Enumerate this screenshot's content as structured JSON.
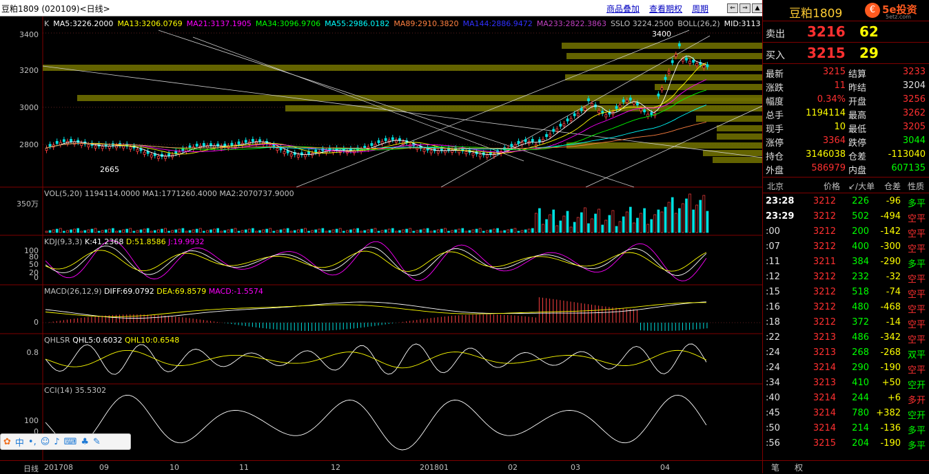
{
  "window": {
    "title": "豆粕1809 (020109)<日线>",
    "links": [
      "商品叠加",
      "查看期权",
      "周期"
    ],
    "nav_buttons": [
      "⇐",
      "⇒",
      "▲",
      "▼"
    ]
  },
  "main_chart": {
    "indicator_line": [
      {
        "text": "K",
        "color": "#c0c0c0"
      },
      {
        "text": "MA5:3226.2000",
        "color": "#ffffff"
      },
      {
        "text": "MA13:3206.0769",
        "color": "#ffff00"
      },
      {
        "text": "MA21:3137.1905",
        "color": "#ff00ff"
      },
      {
        "text": "MA34:3096.9706",
        "color": "#00ff00"
      },
      {
        "text": "MA55:2986.0182",
        "color": "#00ffff"
      },
      {
        "text": "MA89:2910.3820",
        "color": "#ff8040"
      },
      {
        "text": "MA144:2886.9472",
        "color": "#3030ff"
      },
      {
        "text": "MA233:2822.3863",
        "color": "#c040c0"
      },
      {
        "text": "SSLO 3224.2500",
        "color": "#c0c0c0"
      },
      {
        "text": "BOLL(26,2)",
        "color": "#c0c0c0"
      },
      {
        "text": "MID:3113",
        "color": "#ffffff"
      }
    ],
    "y_labels": [
      "3400",
      "3200",
      "3000",
      "2800"
    ],
    "peak_label": "3400",
    "low_label": "2665"
  },
  "vol_panel": {
    "label": "VOL(5,20) 1194114.0000 MA1:1771260.4000 MA2:2070737.9000",
    "y_label": "350万"
  },
  "kdj_panel": {
    "label_prefix": "KDJ(9,3,3)",
    "k": "K:41.2368",
    "d": "D:51.8586",
    "j": "J:19.9932",
    "y_labels": [
      "100",
      "80",
      "50",
      "20",
      "0"
    ]
  },
  "macd_panel": {
    "label_prefix": "MACD(26,12,9)",
    "diff": "DIFF:69.0792",
    "dea": "DEA:69.8579",
    "macd": "MACD:-1.5574",
    "y_label": "0"
  },
  "qhlsr_panel": {
    "label_prefix": "QHLSR",
    "qhl5": "QHL5:0.6032",
    "qhl10": "QHL10:0.6548",
    "y_label": "0.8"
  },
  "cci_panel": {
    "label": "CCI(14) 35.5302",
    "y_labels": [
      "100",
      "0"
    ]
  },
  "x_axis": {
    "period": "日线",
    "labels": [
      "201708",
      "09",
      "10",
      "11",
      "12",
      "201801",
      "02",
      "03",
      "04"
    ]
  },
  "quote": {
    "name": "豆粕1809",
    "logo_text": "5e投资",
    "logo_sub": "5etz.com",
    "ask_label": "卖出",
    "ask_price": "3216",
    "ask_vol": "62",
    "bid_label": "买入",
    "bid_price": "3215",
    "bid_vol": "29",
    "stats": [
      {
        "l1": "最新",
        "v1": "3215",
        "c1": "#ff3030",
        "l2": "结算",
        "v2": "3233",
        "c2": "#ff3030"
      },
      {
        "l1": "涨跌",
        "v1": "11",
        "c1": "#ff3030",
        "l2": "昨结",
        "v2": "3204",
        "c2": "#e0e0e0"
      },
      {
        "l1": "幅度",
        "v1": "0.34%",
        "c1": "#ff3030",
        "l2": "开盘",
        "v2": "3256",
        "c2": "#ff3030"
      },
      {
        "l1": "总手",
        "v1": "1194114",
        "c1": "#ffff00",
        "l2": "最高",
        "v2": "3262",
        "c2": "#ff3030"
      },
      {
        "l1": "现手",
        "v1": "10",
        "c1": "#ffff00",
        "l2": "最低",
        "v2": "3205",
        "c2": "#ff3030"
      },
      {
        "l1": "涨停",
        "v1": "3364",
        "c1": "#ff3030",
        "l2": "跌停",
        "v2": "3044",
        "c2": "#00ff00"
      },
      {
        "l1": "持仓",
        "v1": "3146038",
        "c1": "#ffff00",
        "l2": "仓差",
        "v2": "-113040",
        "c2": "#ffff00"
      },
      {
        "l1": "外盘",
        "v1": "586979",
        "c1": "#ff3030",
        "l2": "内盘",
        "v2": "607135",
        "c2": "#00ff00"
      }
    ],
    "tick_headers": [
      "北京",
      "价格",
      "↙/大单",
      "仓差",
      "性质"
    ],
    "ticks": [
      {
        "time": "23:28",
        "price": "3212",
        "vol": "226",
        "oi": "-96",
        "type": "多平",
        "tc": "#00ff00"
      },
      {
        "time": "23:29",
        "price": "3212",
        "vol": "502",
        "oi": "-494",
        "type": "空平",
        "tc": "#ff3030"
      },
      {
        "time": ":00",
        "price": "3212",
        "vol": "200",
        "oi": "-142",
        "type": "空平",
        "tc": "#ff3030"
      },
      {
        "time": ":07",
        "price": "3212",
        "vol": "400",
        "oi": "-300",
        "type": "空平",
        "tc": "#ff3030"
      },
      {
        "time": ":11",
        "price": "3211",
        "vol": "384",
        "oi": "-290",
        "type": "多平",
        "tc": "#00ff00"
      },
      {
        "time": ":12",
        "price": "3212",
        "vol": "232",
        "oi": "-32",
        "type": "空平",
        "tc": "#ff3030"
      },
      {
        "time": ":15",
        "price": "3212",
        "vol": "518",
        "oi": "-74",
        "type": "空平",
        "tc": "#ff3030"
      },
      {
        "time": ":16",
        "price": "3212",
        "vol": "480",
        "oi": "-468",
        "type": "空平",
        "tc": "#ff3030"
      },
      {
        "time": ":18",
        "price": "3212",
        "vol": "372",
        "oi": "-14",
        "type": "空平",
        "tc": "#ff3030"
      },
      {
        "time": ":22",
        "price": "3213",
        "vol": "486",
        "oi": "-342",
        "type": "空平",
        "tc": "#ff3030"
      },
      {
        "time": ":24",
        "price": "3213",
        "vol": "268",
        "oi": "-268",
        "type": "双平",
        "tc": "#00ff00"
      },
      {
        "time": ":24",
        "price": "3214",
        "vol": "290",
        "oi": "-190",
        "type": "空平",
        "tc": "#ff3030"
      },
      {
        "time": ":34",
        "price": "3213",
        "vol": "410",
        "oi": "+50",
        "type": "空开",
        "tc": "#00ff00"
      },
      {
        "time": ":40",
        "price": "3214",
        "vol": "244",
        "oi": "+6",
        "type": "多开",
        "tc": "#ff3030"
      },
      {
        "time": ":45",
        "price": "3214",
        "vol": "780",
        "oi": "+382",
        "type": "空开",
        "tc": "#00ff00"
      },
      {
        "time": ":50",
        "price": "3214",
        "vol": "214",
        "oi": "-136",
        "type": "多平",
        "tc": "#00ff00"
      },
      {
        "time": ":56",
        "price": "3215",
        "vol": "204",
        "oi": "-190",
        "type": "多平",
        "tc": "#00ff00"
      }
    ],
    "bottom_tabs": [
      "笔",
      "权"
    ]
  },
  "ime": {
    "label": "中"
  }
}
